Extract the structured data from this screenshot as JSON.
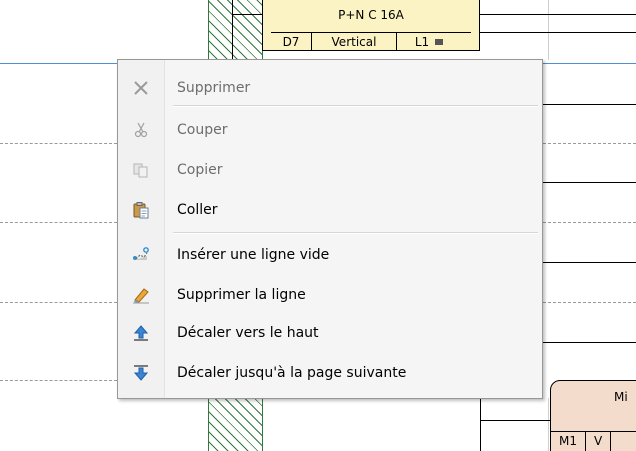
{
  "diagram": {
    "breaker_title": "P+N C 16A",
    "breaker_cells": [
      "D7",
      "Vertical",
      "L1"
    ],
    "partial_block_title": "Mi",
    "partial_block_cells": [
      "M1",
      "V"
    ]
  },
  "context_menu": {
    "items": [
      {
        "label": "Supprimer",
        "icon": "delete-x-icon",
        "enabled": false
      },
      {
        "label": "Couper",
        "icon": "scissors-icon",
        "enabled": false
      },
      {
        "label": "Copier",
        "icon": "copy-icon",
        "enabled": false
      },
      {
        "label": "Coller",
        "icon": "clipboard-paste-icon",
        "enabled": true
      },
      {
        "label": "Insérer une ligne vide",
        "icon": "insert-line-icon",
        "enabled": true
      },
      {
        "label": "Supprimer la ligne",
        "icon": "eraser-icon",
        "enabled": true
      },
      {
        "label": "Décaler vers le haut",
        "icon": "arrow-up-icon",
        "enabled": true
      },
      {
        "label": "Décaler jusqu'à la page suivante",
        "icon": "arrow-down-icon",
        "enabled": true
      }
    ]
  },
  "colors": {
    "accent_line": "#4f8fd4",
    "breaker_fill": "#fbf3c3",
    "block_fill": "#f3dccb",
    "hatch": "#2f7a3a"
  }
}
